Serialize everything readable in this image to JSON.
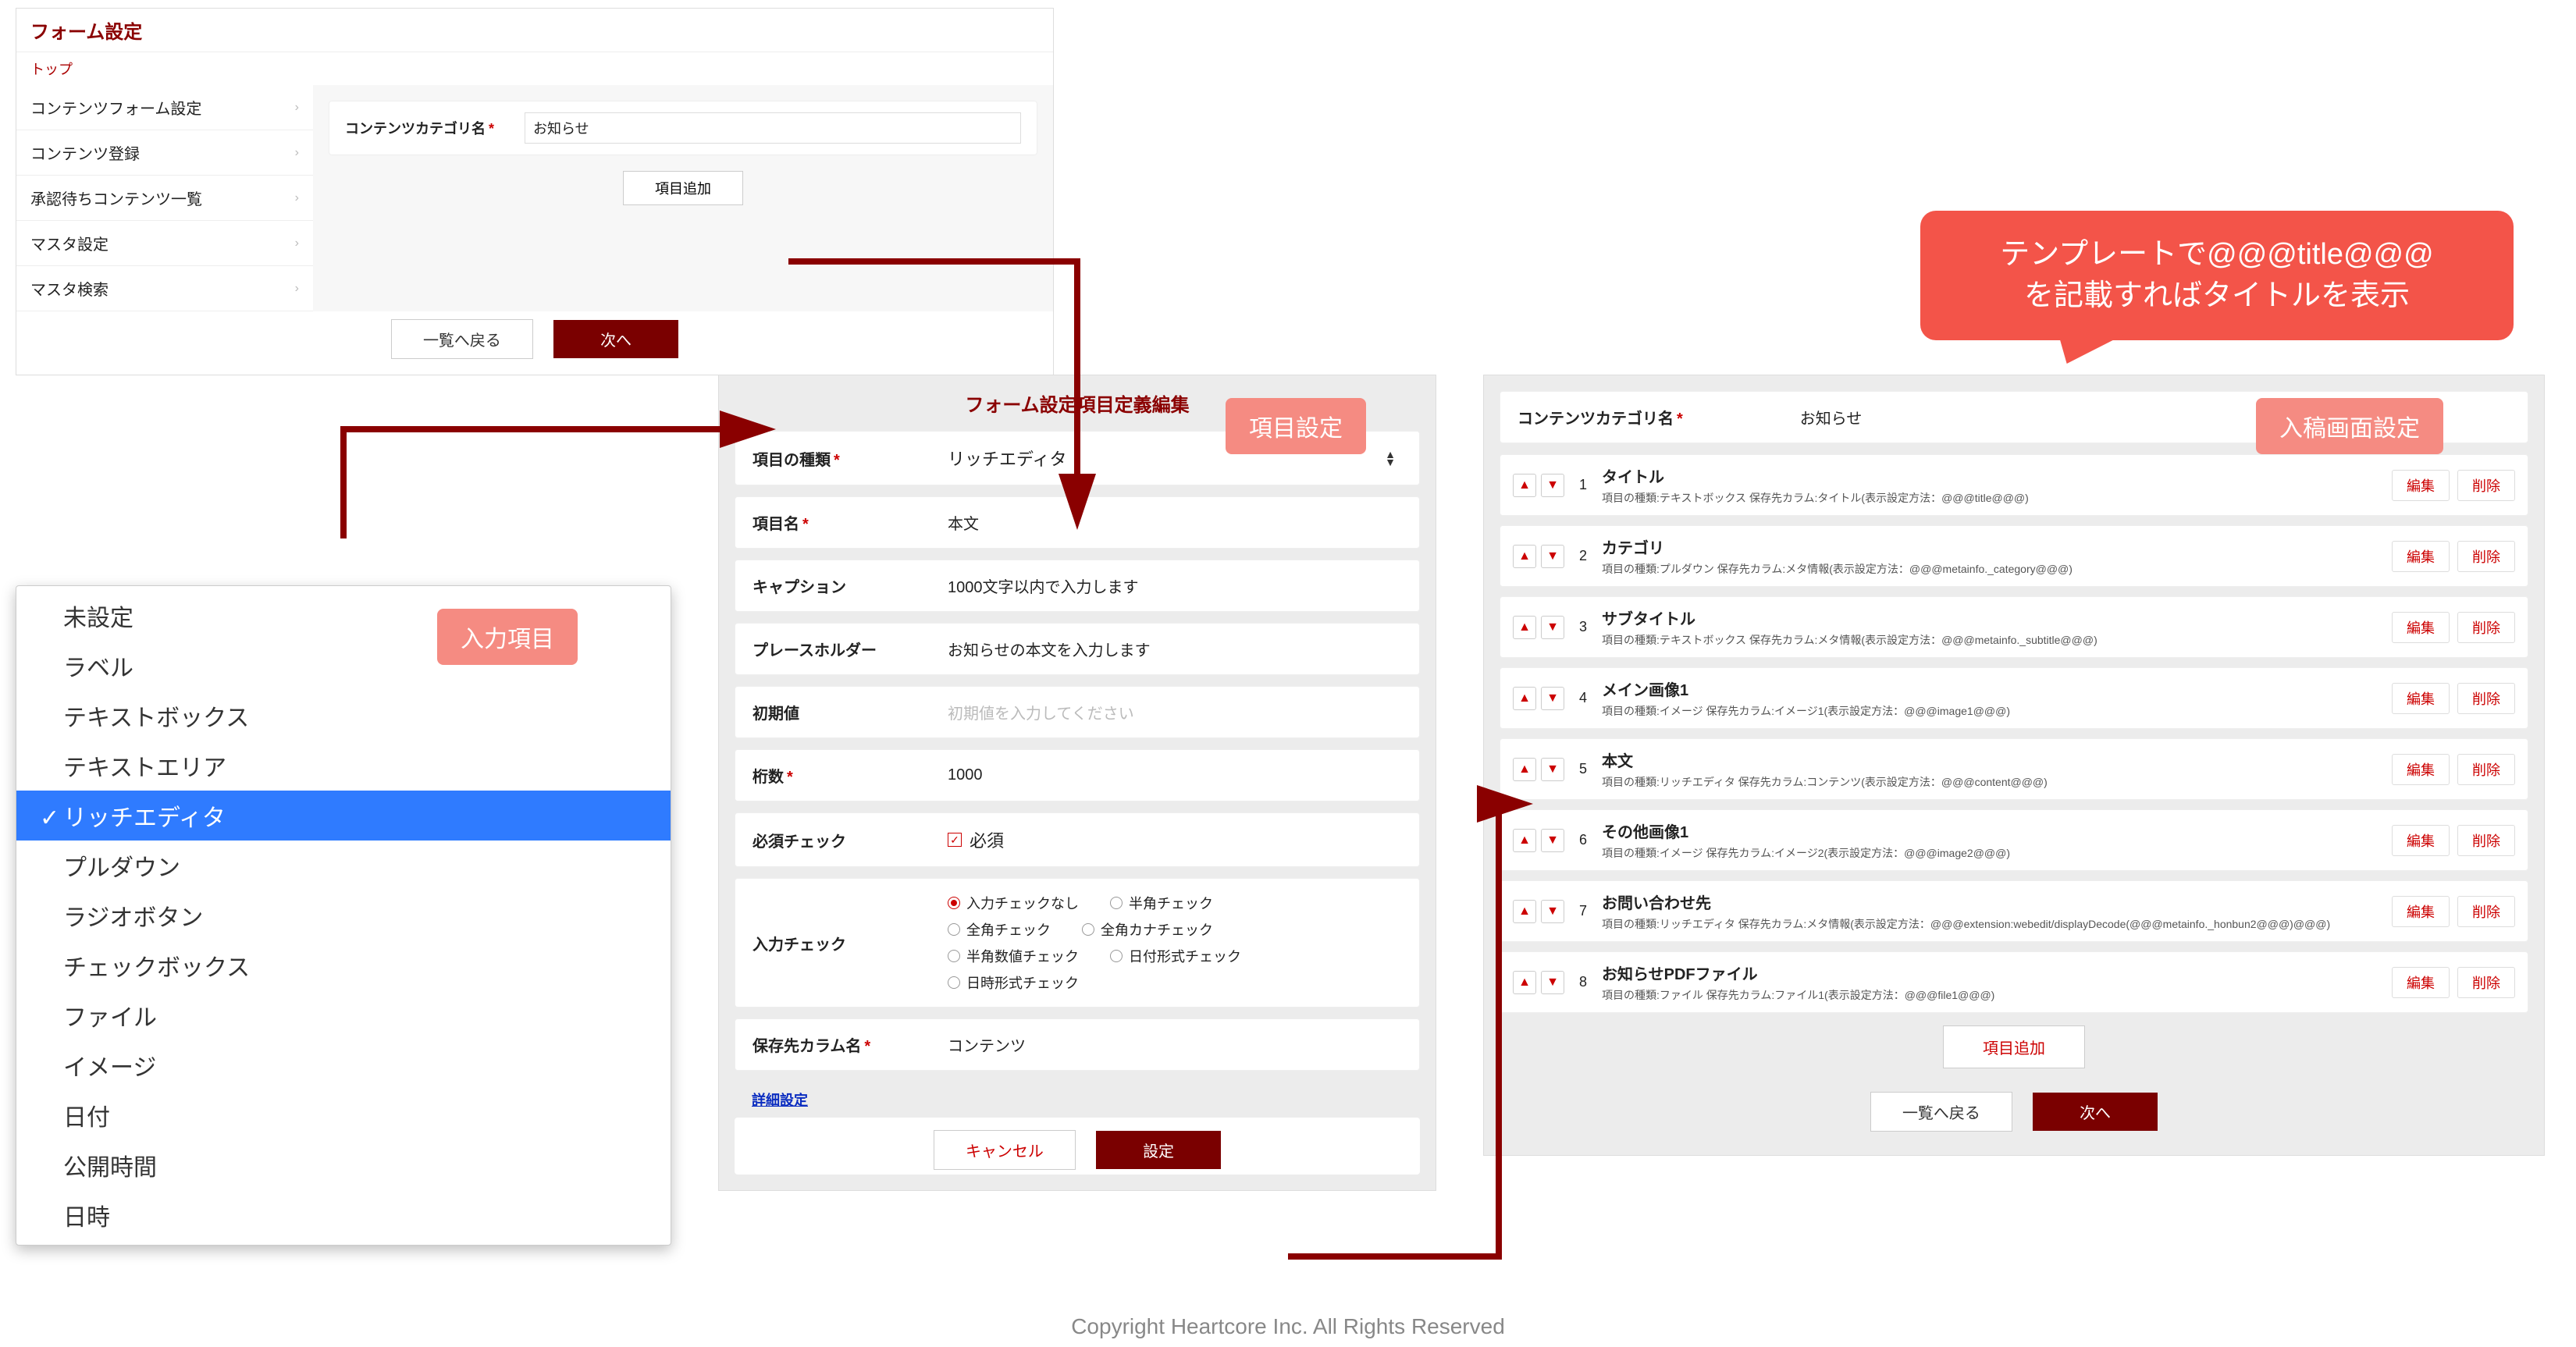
{
  "panel1": {
    "title": "フォーム設定",
    "breadcrumb": "トップ",
    "sidebar": [
      "コンテンツフォーム設定",
      "コンテンツ登録",
      "承認待ちコンテンツ一覧",
      "マスタ設定",
      "マスタ検索"
    ],
    "field_label": "コンテンツカテゴリ名",
    "field_value": "お知らせ",
    "add_button": "項目追加",
    "back_button": "一覧へ戻る",
    "next_button": "次へ"
  },
  "dropdown": {
    "options": [
      "未設定",
      "ラベル",
      "テキストボックス",
      "テキストエリア",
      "リッチエディタ",
      "プルダウン",
      "ラジオボタン",
      "チェックボックス",
      "ファイル",
      "イメージ",
      "日付",
      "公開時間",
      "日時"
    ],
    "selected_index": 4
  },
  "panel3": {
    "title": "フォーム設定項目定義編集",
    "rows": {
      "type_label": "項目の種類",
      "type_value": "リッチエディタ",
      "name_label": "項目名",
      "name_value": "本文",
      "caption_label": "キャプション",
      "caption_value": "1000文字以内で入力します",
      "placeholder_label": "プレースホルダー",
      "placeholder_value": "お知らせの本文を入力します",
      "default_label": "初期値",
      "default_placeholder": "初期値を入力してください",
      "digits_label": "桁数",
      "digits_value": "1000",
      "required_label": "必須チェック",
      "required_text": "必須",
      "validation_label": "入力チェック",
      "validation_options": [
        "入力チェックなし",
        "半角チェック",
        "全角チェック",
        "全角カナチェック",
        "半角数値チェック",
        "日付形式チェック",
        "日時形式チェック"
      ],
      "validation_selected_index": 0,
      "column_label": "保存先カラム名",
      "column_value": "コンテンツ"
    },
    "detail_link": "詳細設定",
    "cancel_button": "キャンセル",
    "submit_button": "設定"
  },
  "panel4": {
    "cat_label": "コンテンツカテゴリ名",
    "cat_value": "お知らせ",
    "items": [
      {
        "title": "タイトル",
        "desc": "項目の種類:テキストボックス 保存先カラム:タイトル(表示設定方法：@@@title@@@)"
      },
      {
        "title": "カテゴリ",
        "desc": "項目の種類:プルダウン 保存先カラム:メタ情報(表示設定方法：@@@metainfo._category@@@)"
      },
      {
        "title": "サブタイトル",
        "desc": "項目の種類:テキストボックス 保存先カラム:メタ情報(表示設定方法：@@@metainfo._subtitle@@@)"
      },
      {
        "title": "メイン画像1",
        "desc": "項目の種類:イメージ 保存先カラム:イメージ1(表示設定方法：@@@image1@@@)"
      },
      {
        "title": "本文",
        "desc": "項目の種類:リッチエディタ 保存先カラム:コンテンツ(表示設定方法：@@@content@@@)"
      },
      {
        "title": "その他画像1",
        "desc": "項目の種類:イメージ 保存先カラム:イメージ2(表示設定方法：@@@image2@@@)"
      },
      {
        "title": "お問い合わせ先",
        "desc": "項目の種類:リッチエディタ 保存先カラム:メタ情報(表示設定方法：@@@extension:webedit/displayDecode(@@@metainfo._honbun2@@@)@@@)"
      },
      {
        "title": "お知らせPDFファイル",
        "desc": "項目の種類:ファイル 保存先カラム:ファイル1(表示設定方法：@@@file1@@@)"
      }
    ],
    "edit_label": "編集",
    "delete_label": "削除",
    "add_button": "項目追加",
    "back_button": "一覧へ戻る",
    "next_button": "次へ"
  },
  "badges": {
    "input_items": "入力項目",
    "item_settings": "項目設定",
    "entry_settings": "入稿画面設定"
  },
  "bubble": {
    "line1": "テンプレートで@@@title@@@",
    "line2": "を記載すればタイトルを表示"
  },
  "copyright": "Copyright Heartcore Inc. All Rights Reserved",
  "colors": {
    "brand_red": "#7a0000",
    "accent_red": "#c00",
    "badge": "#f58b82",
    "bubble": "#f35449",
    "select_blue": "#2f7bff"
  }
}
